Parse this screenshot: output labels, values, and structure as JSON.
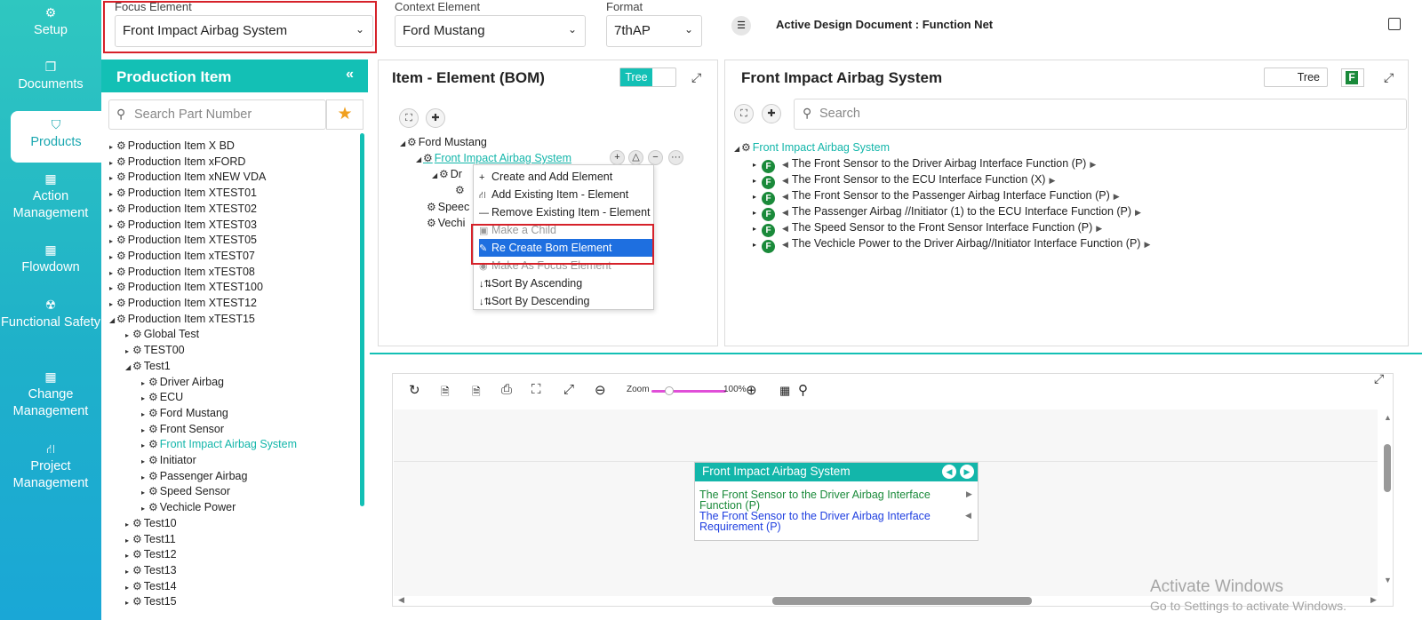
{
  "nav": [
    {
      "label": "Setup",
      "icon": "⚙"
    },
    {
      "label": "Documents",
      "icon": "❐"
    },
    {
      "label": "Products",
      "icon": "⛉"
    },
    {
      "label": "Action Management",
      "icon": "▦"
    },
    {
      "label": "Flowdown",
      "icon": "▦"
    },
    {
      "label": "Functional Safety",
      "icon": "☢"
    },
    {
      "label": "Change Management",
      "icon": "▦"
    },
    {
      "label": "Project Management",
      "icon": "⛙"
    }
  ],
  "topbar": {
    "focus_label": "Focus Element",
    "focus_value": "Front Impact Airbag System",
    "context_label": "Context Element",
    "context_value": "Ford Mustang",
    "format_label": "Format",
    "format_value": "7thAP",
    "active_doc": "Active Design Document : Function Net"
  },
  "production": {
    "title": "Production Item",
    "search_placeholder": "Search Part Number",
    "items": [
      "Production Item X BD",
      "Production Item xFORD",
      "Production Item xNEW VDA",
      "Production Item XTEST01",
      "Production Item XTEST02",
      "Production Item XTEST03",
      "Production Item XTEST05",
      "Production Item xTEST07",
      "Production Item xTEST08",
      "Production Item XTEST100",
      "Production Item XTEST12",
      "Production Item xTEST15"
    ],
    "sub_items": [
      "Global Test",
      "TEST00",
      "Test1"
    ],
    "test1_children": [
      "Driver Airbag",
      "ECU",
      "Ford Mustang",
      "Front Sensor",
      "Front Impact Airbag System",
      "Initiator",
      "Passenger Airbag",
      "Speed Sensor",
      "Vechicle Power"
    ],
    "more_tests": [
      "Test10",
      "Test11",
      "Test12",
      "Test13",
      "Test14",
      "Test15"
    ]
  },
  "bom": {
    "title": "Item - Element (BOM)",
    "toggle_label": "Tree",
    "root": "Ford Mustang",
    "child": "Front Impact Airbag System",
    "child_partial": "Dr",
    "sib1_partial": "Speec",
    "sib2_partial": "Vechi"
  },
  "context_menu": [
    {
      "label": "Create and Add Element",
      "icon": "+"
    },
    {
      "label": "Add Existing Item - Element",
      "icon": "⛙"
    },
    {
      "label": "Remove Existing Item - Element",
      "icon": "—"
    },
    {
      "label": "Make a Child",
      "icon": "▣"
    },
    {
      "label": "Re Create Bom Element",
      "icon": "✎"
    },
    {
      "label": "Make As Focus Element",
      "icon": "◉"
    },
    {
      "label": "Sort By Ascending",
      "icon": "↓⇅"
    },
    {
      "label": "Sort By Descending",
      "icon": "↓⇅"
    }
  ],
  "right_panel": {
    "title": "Front Impact Airbag System",
    "toggle_label": "Tree",
    "f_label": "F",
    "search_placeholder": "Search",
    "root": "Front Impact Airbag System",
    "functions": [
      "The Front Sensor to the Driver Airbag Interface Function (P)",
      "The Front Sensor to the ECU Interface Function (X)",
      "The Front Sensor to the Passenger Airbag Interface Function (P)",
      "The Passenger Airbag //Initiator (1) to the ECU Interface Function (P)",
      "The Speed Sensor to the Front Sensor Interface Function (P)",
      "The Vechicle Power to the Driver Airbag//Initiator Interface Function (P)"
    ]
  },
  "diagram": {
    "zoom_label": "Zoom",
    "zoom_value": "100%",
    "node_title": "Front Impact Airbag System",
    "node_function_line1": "The Front Sensor to the Driver Airbag Interface",
    "node_function_line2": "Function (P)",
    "node_requirement_line1": "The Front Sensor to the Driver Airbag Interface",
    "node_requirement_line2": "Requirement (P)"
  },
  "watermark": {
    "line1": "Activate Windows",
    "line2": "Go to Settings to activate Windows."
  },
  "colors": {
    "accent": "#13c0b5",
    "highlight_red": "#d6222a",
    "selected_blue": "#1e6fe0",
    "function_green": "#1a8a3a",
    "requirement_blue": "#1f3fe0"
  }
}
